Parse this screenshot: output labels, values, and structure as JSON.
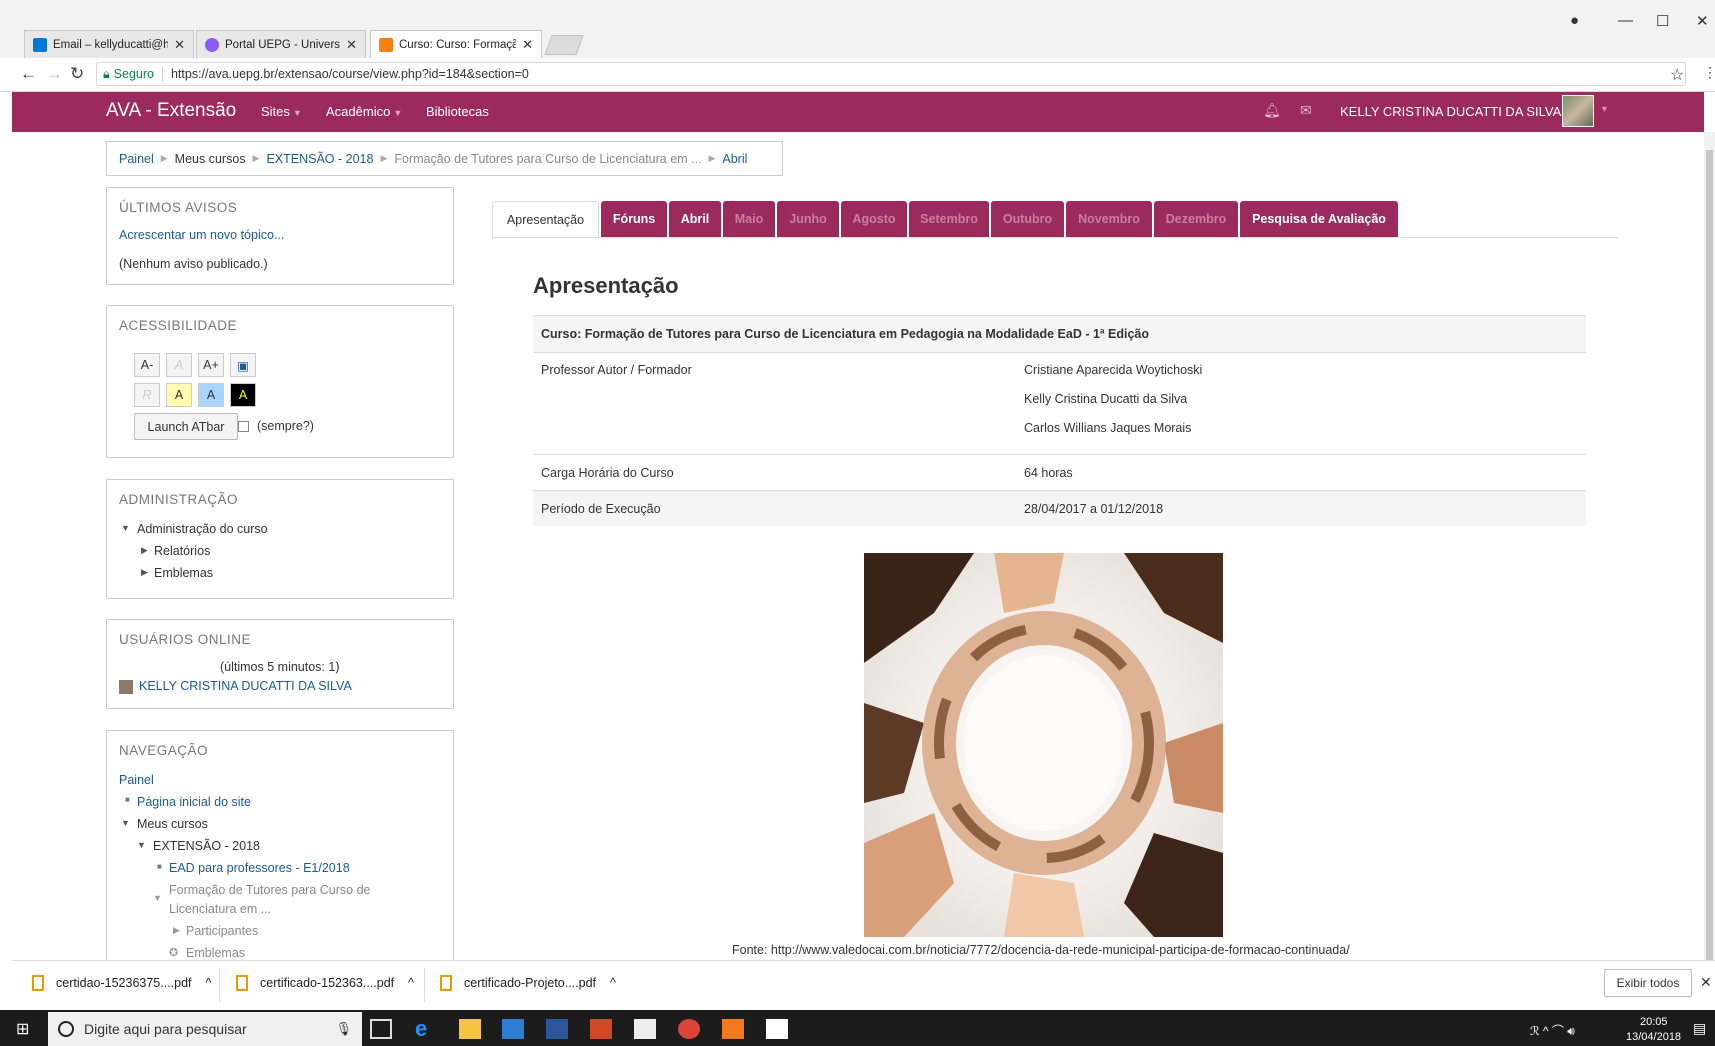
{
  "browser": {
    "tabs": [
      {
        "label": "Email – kellyducatti@hot",
        "favicon_color": "#0078d7"
      },
      {
        "label": "Portal UEPG - Universida",
        "favicon_color": "#8b5cf6"
      },
      {
        "label": "Curso: Curso: Formação",
        "favicon_color": "#f98012"
      }
    ],
    "secure_label": "Seguro",
    "url": "https://ava.uepg.br/extensao/course/view.php?id=184&section=0"
  },
  "navbar": {
    "brand": "AVA - Extensão",
    "menu": [
      "Sites",
      "Acadêmico",
      "Bibliotecas"
    ],
    "user": "KELLY CRISTINA DUCATTI DA SILVA",
    "color": "#9b2b5d"
  },
  "breadcrumb": [
    "Painel",
    "Meus cursos",
    "EXTENSÃO - 2018",
    "Formação de Tutores para Curso de Licenciatura em ...",
    "Abril"
  ],
  "blocks": {
    "avisos": {
      "title": "ÚLTIMOS AVISOS",
      "add": "Acrescentar um novo tópico...",
      "none": "(Nenhum aviso publicado.)"
    },
    "acess": {
      "title": "ACESSIBILIDADE",
      "btns": [
        "A-",
        "A",
        "A+"
      ],
      "colors": [
        "R",
        "A",
        "A",
        "A"
      ],
      "launch": "Launch ATbar",
      "always": "(sempre?)"
    },
    "admin": {
      "title": "ADMINISTRAÇÃO",
      "items": [
        "Administração do curso",
        "Relatórios",
        "Emblemas"
      ]
    },
    "online": {
      "title": "USUÁRIOS ONLINE",
      "sub": "(últimos 5 minutos: 1)",
      "user": "KELLY CRISTINA DUCATTI DA SILVA"
    },
    "nav": {
      "title": "NAVEGAÇÃO",
      "items": [
        "Painel",
        "Página inicial do site",
        "Meus cursos",
        "EXTENSÃO - 2018",
        "EAD para professores - E1/2018",
        "Formação de Tutores para Curso de",
        "Licenciatura em ...",
        "Participantes",
        "Emblemas"
      ]
    }
  },
  "course_tabs": [
    "Apresentação",
    "Fóruns",
    "Abril",
    "Maio",
    "Junho",
    "Agosto",
    "Setembro",
    "Outubro",
    "Novembro",
    "Dezembro",
    "Pesquisa de Avaliação"
  ],
  "section": {
    "title": "Apresentação",
    "course": "Curso: Formação de Tutores para Curso de Licenciatura em Pedagogia na Modalidade EaD - 1ª Edição",
    "prof_label": "Professor Autor / Formador",
    "profs": [
      "Cristiane Aparecida Woytichoski",
      "Kelly Cristina Ducatti da Silva",
      "Carlos Willians Jaques Morais"
    ],
    "carga_label": "Carga Horária do Curso",
    "carga": "64 horas",
    "periodo_label": "Período de Execução",
    "periodo": "28/04/2017 a 01/12/2018",
    "fonte": "Fonte: http://www.valedocai.com.br/noticia/7772/docencia-da-rede-municipal-participa-de-formacao-continuada/"
  },
  "downloads": [
    "certidao-15236375....pdf",
    "certificado-152363....pdf",
    "certificado-Projeto....pdf"
  ],
  "show_all": "Exibir todos",
  "taskbar": {
    "search": "Digite aqui para pesquisar",
    "time": "20:05",
    "date": "13/04/2018"
  }
}
